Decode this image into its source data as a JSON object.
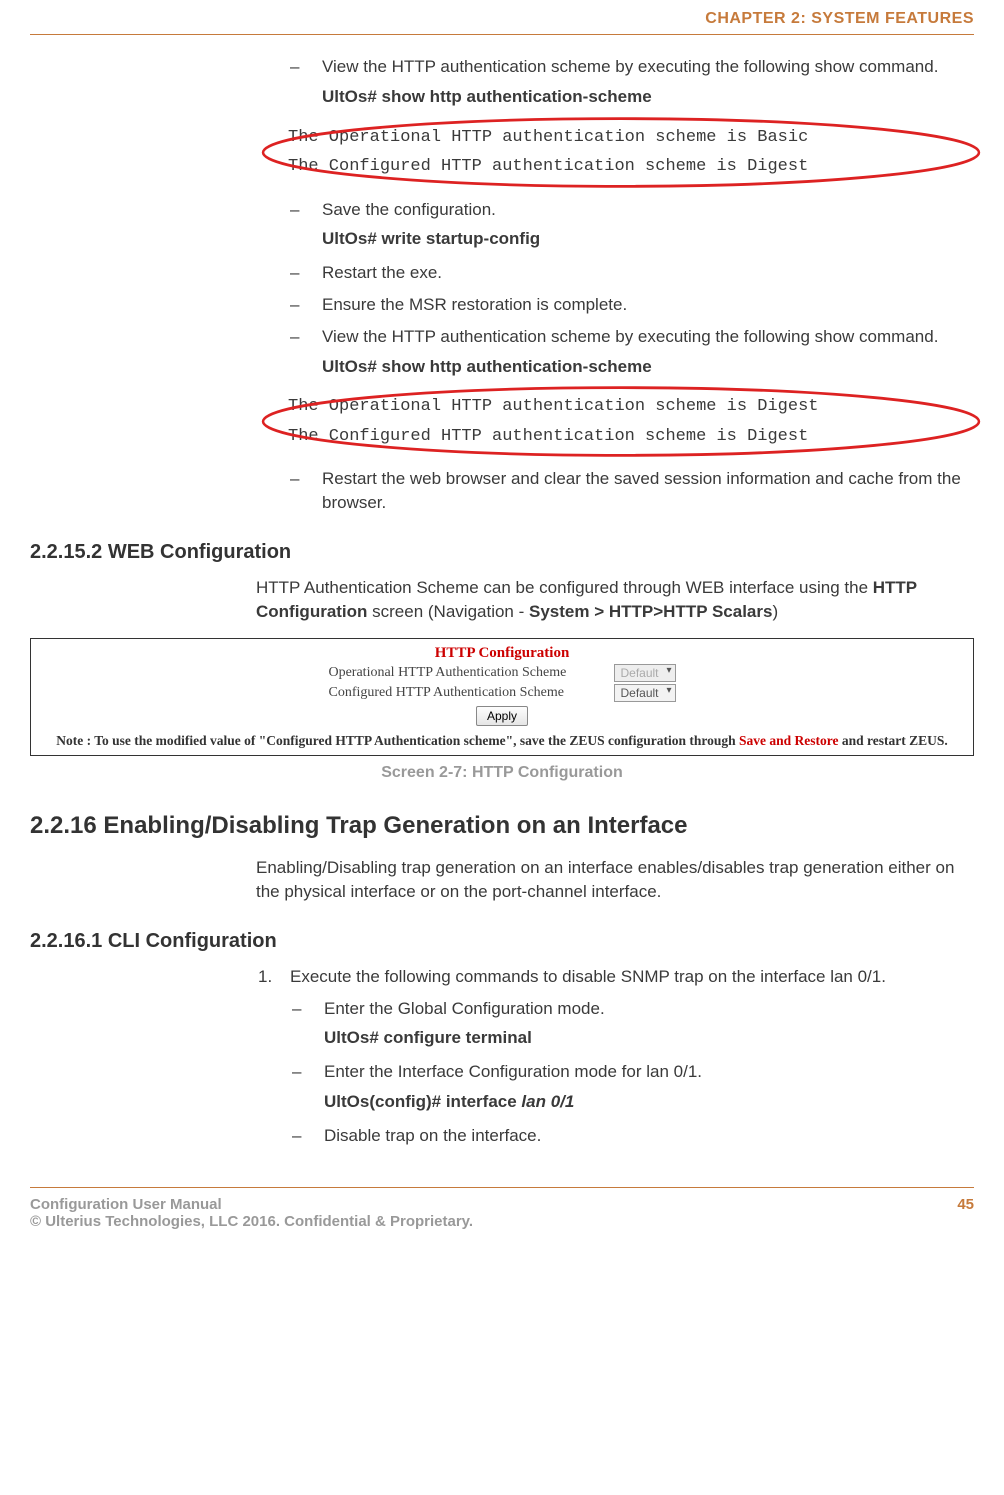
{
  "header": {
    "chapter": "CHAPTER 2: SYSTEM FEATURES"
  },
  "section1": {
    "steps": {
      "view1": "View the HTTP authentication scheme by executing the following show command.",
      "cmd1": "UltOs# show http authentication-scheme",
      "out1a": "The Operational HTTP authentication scheme is Basic",
      "out1b": "The Configured HTTP authentication scheme is Digest",
      "save": "Save the configuration.",
      "cmd2": "UltOs# write startup-config",
      "restart_exe": "Restart the exe.",
      "ensure": "Ensure the MSR restoration is complete.",
      "view2": "View the HTTP authentication scheme by executing the following show command.",
      "cmd3": "UltOs# show http authentication-scheme",
      "out2a": "The Operational HTTP authentication scheme is Digest",
      "out2b": "The Configured HTTP authentication scheme is Digest",
      "restart_browser": "Restart the web browser and clear the saved session information and cache from the browser."
    }
  },
  "section2": {
    "heading": "2.2.15.2   WEB Configuration",
    "para_a": "HTTP Authentication Scheme can be configured through WEB interface using the ",
    "para_b": "HTTP Configuration",
    "para_c": " screen (Navigation - ",
    "para_d": "System > HTTP>HTTP Scalars",
    "para_e": ")"
  },
  "screenshot": {
    "title": "HTTP Configuration",
    "row1_label": "Operational HTTP Authentication Scheme",
    "row1_value": "Default",
    "row2_label": "Configured HTTP Authentication Scheme",
    "row2_value": "Default",
    "apply": "Apply",
    "note_a": "Note : To use the modified value of \"Configured HTTP Authentication scheme\", save the ZEUS configuration through ",
    "note_b": "Save and Restore",
    "note_c": " and restart ZEUS."
  },
  "caption": "Screen 2-7: HTTP Configuration",
  "section3": {
    "heading": "2.2.16   Enabling/Disabling Trap Generation on an Interface",
    "para": "Enabling/Disabling trap generation on an interface enables/disables trap generation either on the physical interface or on the port-channel interface."
  },
  "section4": {
    "heading": "2.2.16.1   CLI Configuration",
    "step1_num": "1.",
    "step1": "Execute the following commands to disable SNMP trap on the interface lan 0/1.",
    "sub1": "Enter the Global Configuration mode.",
    "cmd1": "UltOs# configure terminal",
    "sub2": "Enter the Interface Configuration mode for lan 0/1.",
    "cmd2a": "UltOs(config)# interface ",
    "cmd2b": "lan 0/1",
    "sub3": "Disable trap on the interface."
  },
  "footer": {
    "left1": "Configuration User Manual",
    "left2": "© Ulterius Technologies, LLC 2016. Confidential & Proprietary.",
    "page": "45"
  }
}
